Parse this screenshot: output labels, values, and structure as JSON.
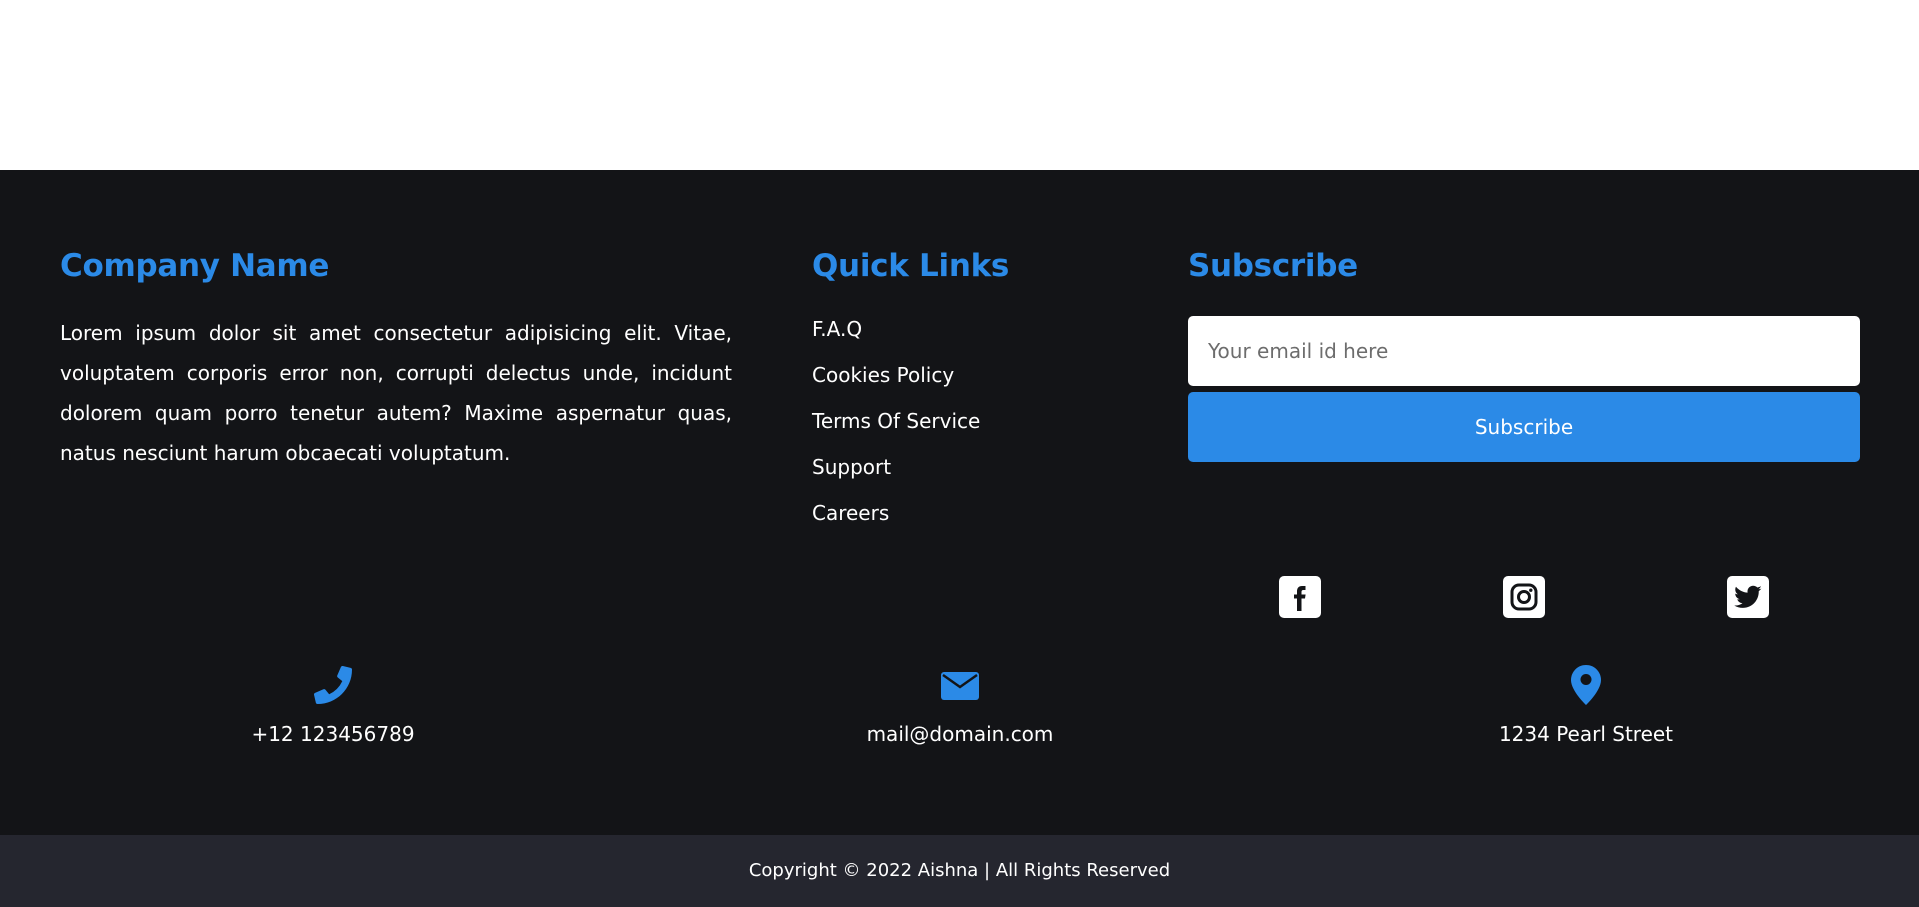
{
  "company": {
    "heading": "Company Name",
    "about": "Lorem ipsum dolor sit amet consectetur adipisicing elit. Vitae, voluptatem corporis error non, corrupti delectus unde, incidunt dolorem quam porro tenetur autem? Maxime aspernatur quas, natus nesciunt harum obcaecati voluptatum."
  },
  "quick_links": {
    "heading": "Quick Links",
    "items": [
      {
        "label": "F.A.Q"
      },
      {
        "label": "Cookies Policy"
      },
      {
        "label": "Terms Of Service"
      },
      {
        "label": "Support"
      },
      {
        "label": "Careers"
      }
    ]
  },
  "subscribe": {
    "heading": "Subscribe",
    "email_placeholder": "Your email id here",
    "email_value": "",
    "button_label": "Subscribe",
    "socials": [
      {
        "icon": "facebook-icon"
      },
      {
        "icon": "instagram-icon"
      },
      {
        "icon": "twitter-icon"
      }
    ]
  },
  "contact": {
    "phone": {
      "icon": "phone-icon",
      "text": "+12 123456789"
    },
    "email": {
      "icon": "envelope-icon",
      "text": "mail@domain.com"
    },
    "address": {
      "icon": "map-pin-icon",
      "text": "1234 Pearl Street"
    }
  },
  "copyright": "Copyright © 2022 Aishna | All Rights Reserved",
  "colors": {
    "accent": "#2b8ae7",
    "footer_bg": "#131417",
    "bottom_bar_bg": "#25262f"
  }
}
